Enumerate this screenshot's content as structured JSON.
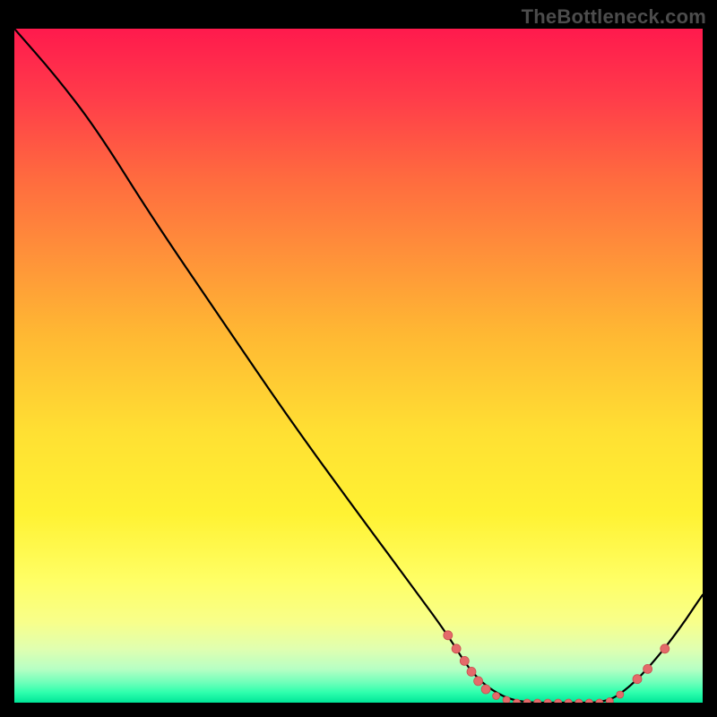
{
  "watermark": "TheBottleneck.com",
  "colors": {
    "curve": "#000000",
    "marker_fill": "#e46a6a",
    "marker_stroke": "#c94f4f"
  },
  "chart_data": {
    "type": "line",
    "title": "",
    "xlabel": "",
    "ylabel": "",
    "xlim": [
      0,
      100
    ],
    "ylim": [
      0,
      100
    ],
    "note": "x and y are in percent of the plot area; y=100 is the top of the gradient, y=0 is the bottom.",
    "curve": [
      {
        "x": 0,
        "y": 100
      },
      {
        "x": 6,
        "y": 93
      },
      {
        "x": 12,
        "y": 85
      },
      {
        "x": 20,
        "y": 72
      },
      {
        "x": 30,
        "y": 57
      },
      {
        "x": 40,
        "y": 42
      },
      {
        "x": 50,
        "y": 28
      },
      {
        "x": 58,
        "y": 17
      },
      {
        "x": 63,
        "y": 10
      },
      {
        "x": 66,
        "y": 5
      },
      {
        "x": 69,
        "y": 2
      },
      {
        "x": 73,
        "y": 0
      },
      {
        "x": 80,
        "y": 0
      },
      {
        "x": 86,
        "y": 0
      },
      {
        "x": 89,
        "y": 2
      },
      {
        "x": 92,
        "y": 5
      },
      {
        "x": 96,
        "y": 10
      },
      {
        "x": 100,
        "y": 16
      }
    ],
    "markers": [
      {
        "x": 63.0,
        "y": 10.0,
        "r": 5
      },
      {
        "x": 64.2,
        "y": 8.0,
        "r": 5
      },
      {
        "x": 65.4,
        "y": 6.2,
        "r": 5
      },
      {
        "x": 66.4,
        "y": 4.6,
        "r": 5
      },
      {
        "x": 67.4,
        "y": 3.2,
        "r": 5
      },
      {
        "x": 68.5,
        "y": 2.0,
        "r": 5
      },
      {
        "x": 70.0,
        "y": 1.0,
        "r": 4
      },
      {
        "x": 71.5,
        "y": 0.4,
        "r": 4
      },
      {
        "x": 73.0,
        "y": 0.0,
        "r": 4
      },
      {
        "x": 74.5,
        "y": 0.0,
        "r": 4
      },
      {
        "x": 76.0,
        "y": 0.0,
        "r": 4
      },
      {
        "x": 77.5,
        "y": 0.0,
        "r": 4
      },
      {
        "x": 79.0,
        "y": 0.0,
        "r": 4
      },
      {
        "x": 80.5,
        "y": 0.0,
        "r": 4
      },
      {
        "x": 82.0,
        "y": 0.0,
        "r": 4
      },
      {
        "x": 83.5,
        "y": 0.0,
        "r": 4
      },
      {
        "x": 85.0,
        "y": 0.0,
        "r": 4
      },
      {
        "x": 86.5,
        "y": 0.2,
        "r": 4
      },
      {
        "x": 88.0,
        "y": 1.2,
        "r": 4
      },
      {
        "x": 90.5,
        "y": 3.5,
        "r": 5
      },
      {
        "x": 92.0,
        "y": 5.0,
        "r": 5
      },
      {
        "x": 94.5,
        "y": 8.0,
        "r": 5
      }
    ]
  }
}
